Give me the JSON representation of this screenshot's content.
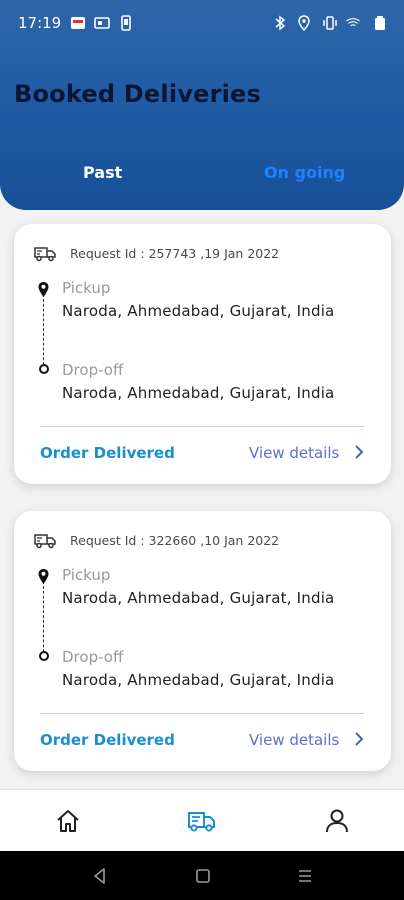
{
  "status_bar": {
    "time": "17:19"
  },
  "header": {
    "title": "Booked Deliveries",
    "tabs": [
      {
        "label": "Past",
        "active": true
      },
      {
        "label": "On going",
        "active": false
      }
    ]
  },
  "deliveries": [
    {
      "request_text": "Request Id : 257743 ,19 Jan 2022",
      "pickup_label": "Pickup",
      "pickup_address": "Naroda, Ahmedabad, Gujarat, India",
      "dropoff_label": "Drop-off",
      "dropoff_address": "Naroda, Ahmedabad, Gujarat, India",
      "status": "Order Delivered",
      "details_label": "View details"
    },
    {
      "request_text": "Request Id : 322660 ,10 Jan 2022",
      "pickup_label": "Pickup",
      "pickup_address": "Naroda, Ahmedabad, Gujarat, India",
      "dropoff_label": "Drop-off",
      "dropoff_address": "Naroda, Ahmedabad, Gujarat, India",
      "status": "Order Delivered",
      "details_label": "View details"
    }
  ],
  "bottom_nav": {
    "items": [
      {
        "icon": "home-icon",
        "active": false
      },
      {
        "icon": "delivery-truck-icon",
        "active": true
      },
      {
        "icon": "profile-icon",
        "active": false
      }
    ]
  },
  "colors": {
    "header_top": "#2f66a8",
    "header_bottom": "#174f97",
    "active_tab": "#ffffff",
    "inactive_tab": "#1c84ff",
    "status_text": "#1a8fd0",
    "details_link": "#5b6fd0",
    "nav_active": "#1a8fd0"
  }
}
